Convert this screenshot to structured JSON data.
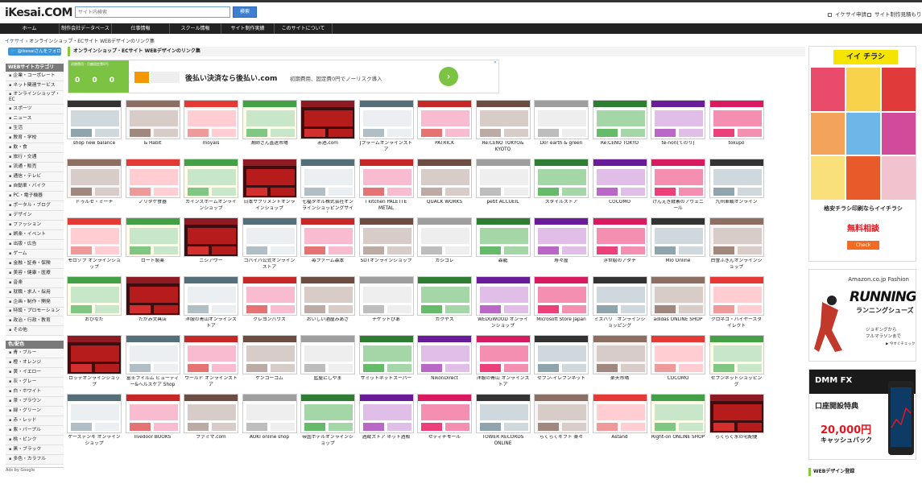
{
  "header": {
    "logo": "iKesai.COM",
    "search_placeholder": "サイト内検索",
    "search_button": "検索",
    "links": [
      "イケサイ申請",
      "サイト制作見積もり"
    ]
  },
  "nav": [
    "ホーム",
    "制作会社データベース",
    "仕事情報",
    "スクール情報",
    "サイト制作実績",
    "このサイトについて"
  ],
  "breadcrumb": {
    "home": "イケサイ",
    "sep": " › ",
    "current": "オンラインショップ・ECサイト WEBデザインのリンク集"
  },
  "follow_button": "@ikesaiさんをフォロー",
  "page_title": "オンラインショップ・ECサイト WEBデザインのリンク集",
  "sidebar": {
    "section1_title": "WEBサイトカテゴリ",
    "section1": [
      "企業・コーポレート",
      "ネット関連サービス",
      "オンラインショップ・EC",
      "スポーツ",
      "ニュース",
      "生活",
      "教育・学校",
      "飲・食",
      "旅行・交通",
      "流通・販売",
      "通信・テレビ",
      "自動車・バイク",
      "PC・電子機器",
      "ポータル・ブログ",
      "デザイン",
      "ファッション",
      "娯楽・イベント",
      "出版・広告",
      "ゲーム",
      "金融・証券・保険",
      "美容・健康・医療",
      "音楽",
      "就職・求人・採用",
      "企画・制作・開発",
      "特設・プロモーション",
      "政治・行政・教育",
      "その他"
    ],
    "section2_title": "色/配色",
    "section2": [
      "青・ブルー",
      "橙・オレンジ",
      "黄・イエロー",
      "灰・グレー",
      "白・ホワイト",
      "茶・ブラウン",
      "緑・グリーン",
      "赤・レッド",
      "紫・パープル",
      "桃・ピンク",
      "黒・ブラック",
      "多色・カラフル"
    ],
    "ads_label": "Ads by Google"
  },
  "ad_banner": {
    "caption": "初期費用・月額固定費0円",
    "zeros": "0 0 0",
    "headline": "後払い決済なら後払い.com",
    "sub": "初期費用、固定費0円でノーリスク導入",
    "close": "✕"
  },
  "sites": [
    "shop new balance",
    "& Habit",
    "moyais",
    "漁師さん直送市場",
    "赤酒.com",
    "Jフラームオンラインストア",
    "PATRICK",
    "Re:CENO TOKYO& KYOTO",
    "Do! earth & green",
    "Re:CENO TOKYO",
    "te-nori(てのり)",
    "tokupo",
    "ドゥルセ・ミーナ",
    "ノリタケ食器",
    "カインズホームオンラインショップ",
    "日本サプリメントオンラインショップ",
    "七福タオル株式会社オンラインショッピングサイト",
    "i kitchen PALETTE METAL",
    "QUACK WORKS",
    "petit ACCUEIL",
    "スタイルストア",
    "COCOMO",
    "げんえき酵素のアヴェニール",
    "九州車輌オンライン",
    "モロゾフ オンラインショップ",
    "ロート製薬",
    "ニシアワー",
    "コバイバ公式オンラインストア",
    "苺ファーム森本",
    "SDTオンラインショップ",
    "カシコレ",
    "森籠",
    "寿々屋",
    "浮世絵のアダチ",
    "Mio Online",
    "白雪ふきんオンラインショップ",
    "おびなた",
    "たがみ文具店",
    "洋服の青山オンラインストア",
    "クレヨンハウス",
    "おいしい酒屋みあさ",
    "チケットぴあ",
    "カクヤス",
    "WEDGWOOD オンラインショップ",
    "Microsoft Store Japan",
    "ミスバリ　オンラインショッピング",
    "adidas ONLINE SHOP",
    "クロネコ・バイヤーズダイレクト",
    "ロッテオンラインショップ",
    "富士フイルム ビューティー&ヘルスケア Shop",
    "ワールド オンラインストア",
    "ケンコーコム",
    "藍屋にしやま",
    "サミットネットスーパー",
    "NikonDirect",
    "洋服の青山 オンラインストア",
    "セブン-イレブンネット",
    "楽天市場",
    "COCOMO",
    "セブンネットショッピング",
    "ケーズデンキ オンラインショップ",
    "livedoor BOOKS",
    "ファミマ.com",
    "AOKI online shop",
    "帝国ホテルオンラインショップ",
    "酒蔵ストア ネット酒販",
    "セディナモール",
    "TOWER RECORDS ONLINE",
    "らくらくギフト 楽々",
    "Astand",
    "Right-on ONLINE SHOP",
    "らくらく水の宅配便"
  ],
  "right_ads": {
    "ad1": {
      "brand": "イイ チラシ",
      "line1": "格安チラシ印刷ならイイチラシ",
      "line2": "無料相談",
      "button": "Check"
    },
    "ad2": {
      "top": "Amazon.co.jp Fashion",
      "title": "RUNNING",
      "jp": "ランニングシューズ",
      "s1": "ジョギングから",
      "s2": "フルマラソンまで",
      "s3": "▶ 今すぐチェック"
    },
    "ad3": {
      "brand": "DMM FX",
      "l1": "口座開設特典",
      "l2": "20,000円",
      "l3": "キャッシュバック"
    }
  },
  "web_design_head": "WEBデザイン登録",
  "colors": {
    "nav_bg": "#222222",
    "accent_green": "#8cc63f",
    "search_blue": "#3c7fd3"
  }
}
